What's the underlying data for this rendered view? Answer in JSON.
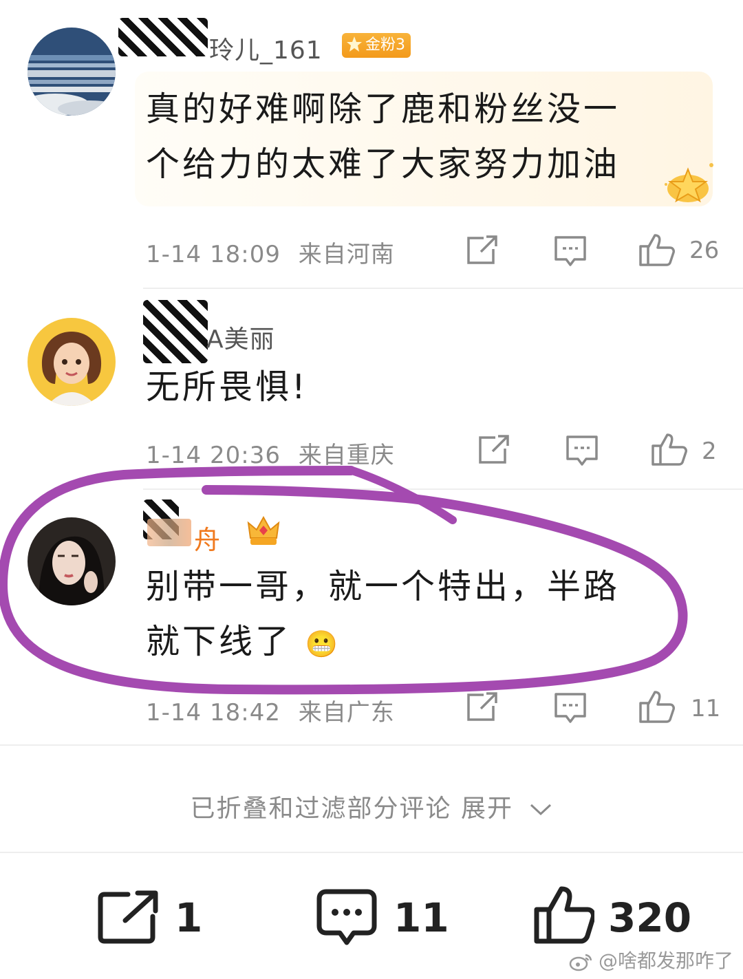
{
  "comments": [
    {
      "username": "玲儿_161",
      "badge": "金粉3",
      "text_line1": "真的好难啊除了鹿和粉丝没一",
      "text_line2": "个给力的太难了大家努力加油",
      "time": "1-14 18:09",
      "location": "来自河南",
      "likes": "26"
    },
    {
      "username": "A美丽",
      "text_line1": "无所畏惧!",
      "time": "1-14 20:36",
      "location": "来自重庆",
      "likes": "2"
    },
    {
      "username": "舟",
      "text_line1": "别带一哥，就一个特出，半路",
      "text_line2": "就下线了",
      "emoji": "😬",
      "time": "1-14 18:42",
      "location": "来自广东",
      "likes": "11"
    }
  ],
  "collapsed_notice": "已折叠和过滤部分评论 展开",
  "bottom_bar": {
    "share_count": "1",
    "comment_count": "11",
    "like_count": "320"
  },
  "watermark": "@啥都发那咋了",
  "highlight_color": "#a44ab0"
}
